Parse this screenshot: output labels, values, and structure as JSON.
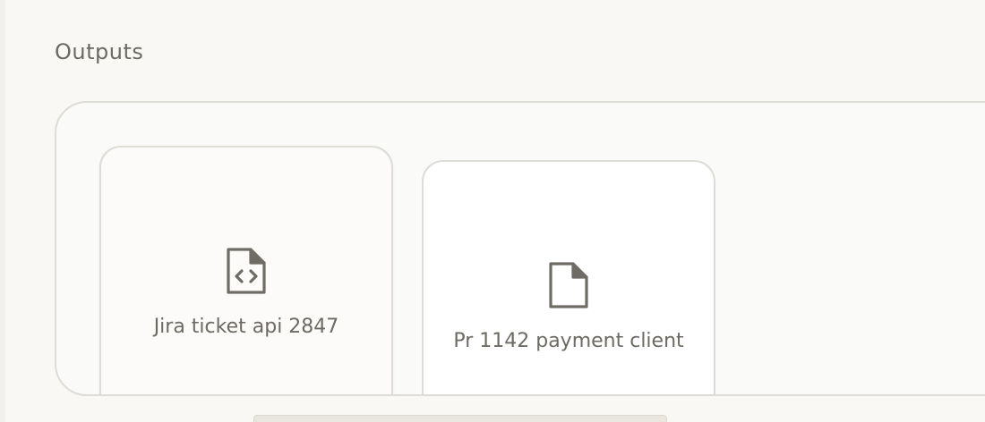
{
  "section": {
    "title": "Outputs"
  },
  "outputs": [
    {
      "label": "Jira ticket api 2847",
      "icon": "code-file-icon"
    },
    {
      "label": "Pr 1142 payment client",
      "icon": "file-icon"
    }
  ],
  "colors": {
    "text": "#6d6a64",
    "border": "#dedcd7",
    "background": "#f9f8f5",
    "icon": "#6f6c66"
  }
}
